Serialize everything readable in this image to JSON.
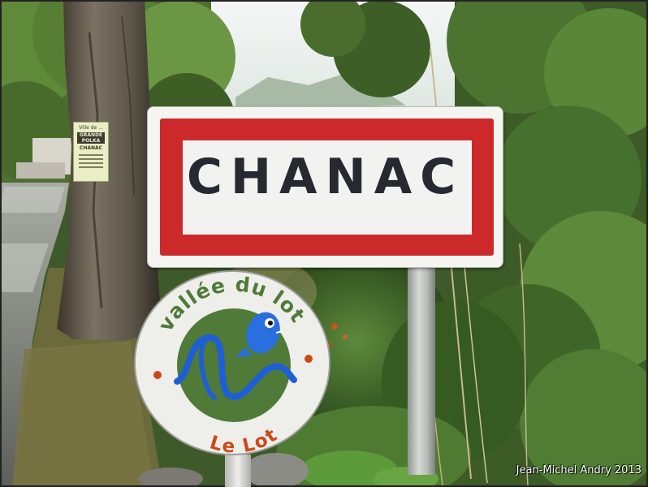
{
  "scene": {
    "kind": "roadside town entry sign photograph",
    "colors": {
      "sign_red": "#cc2a2a",
      "sign_text": "#262a30",
      "badge_green": "#4f7a38",
      "badge_blue": "#1f5fd4",
      "badge_orange": "#cc4a18"
    }
  },
  "town_sign": {
    "name": "CHANAC"
  },
  "badge_sign": {
    "top_text": "vallée du lot",
    "bottom_text": "Le Lot",
    "logo": "fish-river-icon"
  },
  "poster": {
    "line1": "Ville de ...",
    "line2": "GRANDE POLKA",
    "line3": "CHANAC"
  },
  "caption": "Jean-Michel Andry 2013"
}
